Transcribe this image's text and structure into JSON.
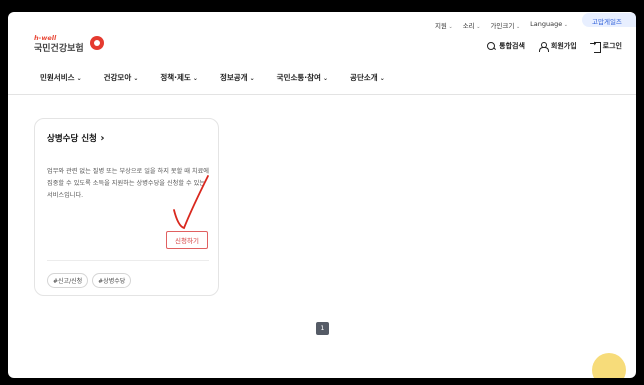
{
  "util_bar": {
    "items": [
      "지원",
      "소리",
      "가인크기",
      "Language"
    ],
    "zoom_label": "고맙게일즈"
  },
  "logo": {
    "small": "h-well",
    "main": "국민건강보험"
  },
  "header": {
    "search": "통합검색",
    "join": "회원가입",
    "login": "로그인"
  },
  "nav": [
    "민원서비스",
    "건강모아",
    "정책·제도",
    "정보공개",
    "국민소통·참여",
    "공단소개"
  ],
  "card": {
    "title": "상병수당 신청",
    "description": "업무와 관련 없는 질병 또는 부상으로 일을 하지 못할 때 치료에 집중할 수 있도록 소득을 지원하는 상병수당을 신청할 수 있는 서비스입니다.",
    "button": "신청하기",
    "tags": [
      "#신고/신청",
      "#상병수당"
    ]
  },
  "pagination": {
    "current": "1"
  },
  "colors": {
    "accent_red": "#e53a2f",
    "button_red": "#d43a3a",
    "float_yellow": "#f6d86b"
  }
}
